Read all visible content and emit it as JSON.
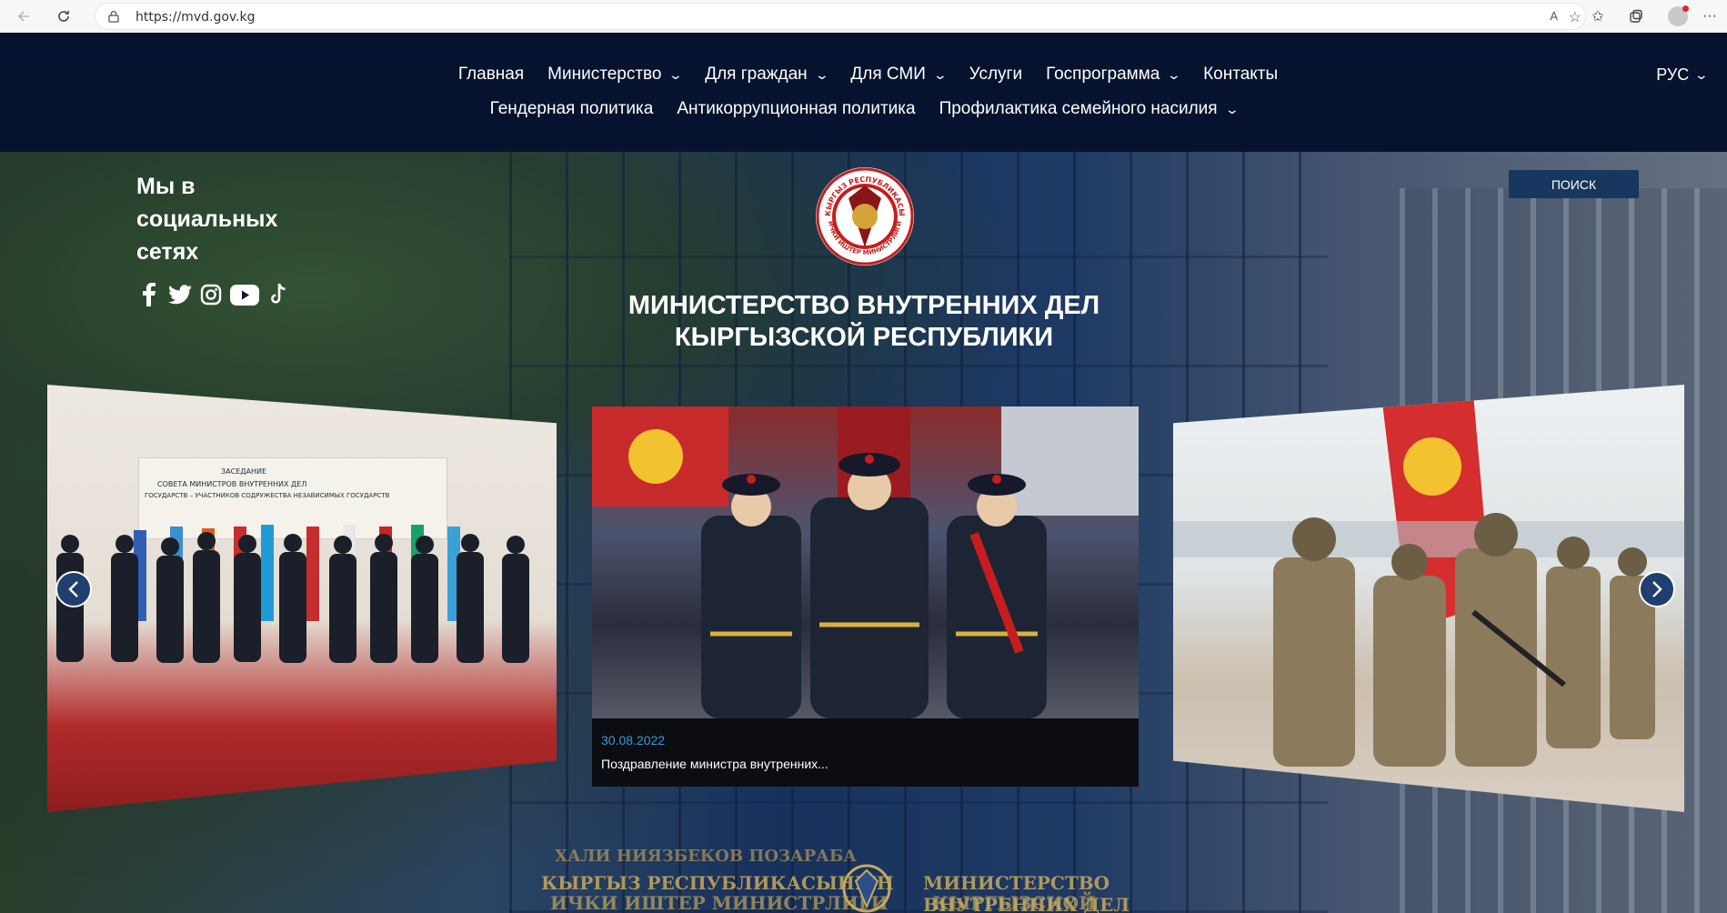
{
  "browser": {
    "url": "https://mvd.gov.kg",
    "read_aloud_label": "A",
    "icons": [
      "back-icon",
      "reload-icon",
      "lock-icon",
      "read-aloud-icon",
      "add-favorite-icon",
      "favorites-icon",
      "collections-icon",
      "profile-avatar",
      "more-icon"
    ]
  },
  "nav": {
    "row1": [
      {
        "label": "Главная",
        "dropdown": false
      },
      {
        "label": "Министерство",
        "dropdown": true
      },
      {
        "label": "Для граждан",
        "dropdown": true
      },
      {
        "label": "Для СМИ",
        "dropdown": true
      },
      {
        "label": "Услуги",
        "dropdown": false
      },
      {
        "label": "Госпрограмма",
        "dropdown": true
      },
      {
        "label": "Контакты",
        "dropdown": false
      }
    ],
    "row2": [
      {
        "label": "Гендерная политика",
        "dropdown": false
      },
      {
        "label": "Антикоррупционная политика",
        "dropdown": false
      },
      {
        "label": "Профилактика семейного насилия",
        "dropdown": true
      }
    ],
    "language": "РУС"
  },
  "hero": {
    "social_title": "Мы в социальных сетях",
    "social_icons": [
      "facebook-icon",
      "twitter-icon",
      "instagram-icon",
      "youtube-icon",
      "tiktok-icon"
    ],
    "search_label": "ПОИСК",
    "title_line1": "МИНИСТЕРСТВО ВНУТРЕННИХ ДЕЛ",
    "title_line2": "КЫРГЫЗСКОЙ РЕСПУБЛИКИ",
    "emblem_text_top": "КЫРГЫЗ РЕСПУБЛИКАСЫ",
    "emblem_text_bottom": "ИЧКИ ИШТЕР МИНИСТРЛИГИ",
    "plaque_left_1": "КЫРГЫЗ РЕСПУБЛИКАСЫНЫН",
    "plaque_left_2": "ИЧКИ ИШТЕР МИНИСТРЛИГИ",
    "plaque_right_1": "МИНИСТЕРСТВО ВНУТРЕННИХ ДЕЛ",
    "plaque_right_2": "КЫРГЫЗСКОЙ РЕСПУБЛИКИ",
    "plaque_top": "ХАЛИ НИЯЗБЕКОВ ПОЗАРАБА"
  },
  "carousel": {
    "left_slide": {
      "banner_text_1": "ЗАСЕДАНИЕ",
      "banner_text_2": "СОВЕТА МИНИСТРОВ ВНУТРЕННИХ ДЕЛ",
      "banner_text_3": "ГОСУДАРСТВ – УЧАСТНИКОВ СОДРУЖЕСТВА НЕЗАВИСИМЫХ ГОСУДАРСТВ"
    },
    "center_slide": {
      "date": "30.08.2022",
      "caption": "Поздравление министра внутренних..."
    },
    "prev_icon": "chevron-left-icon",
    "next_icon": "chevron-right-icon"
  },
  "colors": {
    "header_bg": "#07132e",
    "search_bg": "#17375e",
    "date_color": "#3f9bd6",
    "arrow_bg": "#1f3f6e"
  }
}
